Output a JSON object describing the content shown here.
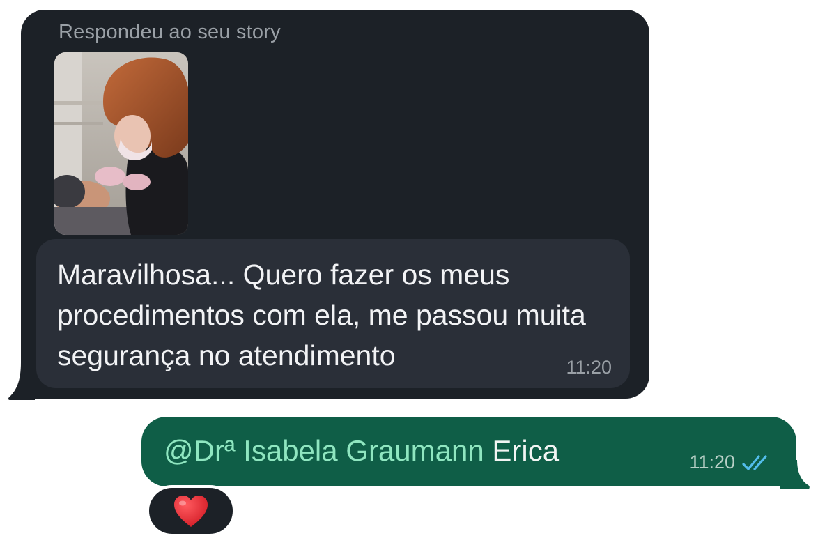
{
  "incoming": {
    "story_label": "Respondeu ao seu story",
    "message": "Maravilhosa... Quero fazer os meus procedimentos com ela, me passou muita segurança no atendimento",
    "time": "11:20"
  },
  "outgoing": {
    "mention": "@Drª Isabela Graumann",
    "text": " Erica",
    "time": "11:20",
    "status": "read"
  },
  "reaction": {
    "emoji": "heart-icon"
  },
  "colors": {
    "incoming_bubble": "#1c2127",
    "reply_box": "#2a2f38",
    "outgoing_bubble": "#0f5e47",
    "mention": "#8fe6c0",
    "read_ticks": "#53bdeb",
    "heart": "#e0242e"
  }
}
